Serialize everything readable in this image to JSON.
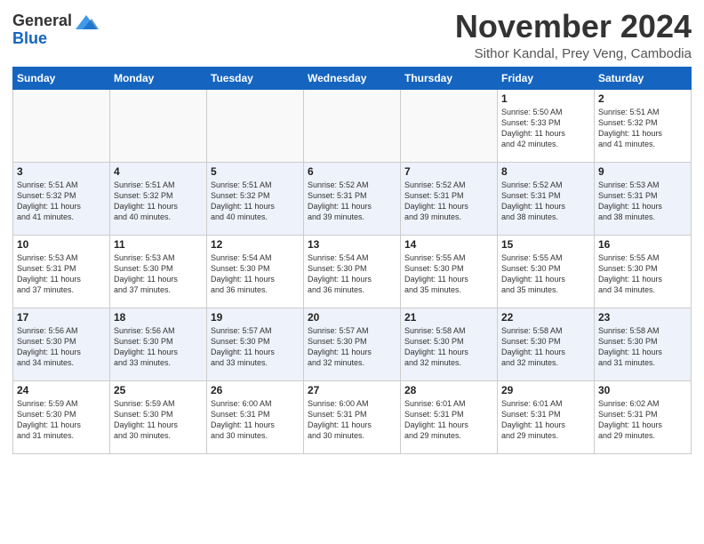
{
  "logo": {
    "general": "General",
    "blue": "Blue"
  },
  "header": {
    "month": "November 2024",
    "location": "Sithor Kandal, Prey Veng, Cambodia"
  },
  "weekdays": [
    "Sunday",
    "Monday",
    "Tuesday",
    "Wednesday",
    "Thursday",
    "Friday",
    "Saturday"
  ],
  "weeks": [
    [
      {
        "day": "",
        "info": ""
      },
      {
        "day": "",
        "info": ""
      },
      {
        "day": "",
        "info": ""
      },
      {
        "day": "",
        "info": ""
      },
      {
        "day": "",
        "info": ""
      },
      {
        "day": "1",
        "info": "Sunrise: 5:50 AM\nSunset: 5:33 PM\nDaylight: 11 hours\nand 42 minutes."
      },
      {
        "day": "2",
        "info": "Sunrise: 5:51 AM\nSunset: 5:32 PM\nDaylight: 11 hours\nand 41 minutes."
      }
    ],
    [
      {
        "day": "3",
        "info": "Sunrise: 5:51 AM\nSunset: 5:32 PM\nDaylight: 11 hours\nand 41 minutes."
      },
      {
        "day": "4",
        "info": "Sunrise: 5:51 AM\nSunset: 5:32 PM\nDaylight: 11 hours\nand 40 minutes."
      },
      {
        "day": "5",
        "info": "Sunrise: 5:51 AM\nSunset: 5:32 PM\nDaylight: 11 hours\nand 40 minutes."
      },
      {
        "day": "6",
        "info": "Sunrise: 5:52 AM\nSunset: 5:31 PM\nDaylight: 11 hours\nand 39 minutes."
      },
      {
        "day": "7",
        "info": "Sunrise: 5:52 AM\nSunset: 5:31 PM\nDaylight: 11 hours\nand 39 minutes."
      },
      {
        "day": "8",
        "info": "Sunrise: 5:52 AM\nSunset: 5:31 PM\nDaylight: 11 hours\nand 38 minutes."
      },
      {
        "day": "9",
        "info": "Sunrise: 5:53 AM\nSunset: 5:31 PM\nDaylight: 11 hours\nand 38 minutes."
      }
    ],
    [
      {
        "day": "10",
        "info": "Sunrise: 5:53 AM\nSunset: 5:31 PM\nDaylight: 11 hours\nand 37 minutes."
      },
      {
        "day": "11",
        "info": "Sunrise: 5:53 AM\nSunset: 5:30 PM\nDaylight: 11 hours\nand 37 minutes."
      },
      {
        "day": "12",
        "info": "Sunrise: 5:54 AM\nSunset: 5:30 PM\nDaylight: 11 hours\nand 36 minutes."
      },
      {
        "day": "13",
        "info": "Sunrise: 5:54 AM\nSunset: 5:30 PM\nDaylight: 11 hours\nand 36 minutes."
      },
      {
        "day": "14",
        "info": "Sunrise: 5:55 AM\nSunset: 5:30 PM\nDaylight: 11 hours\nand 35 minutes."
      },
      {
        "day": "15",
        "info": "Sunrise: 5:55 AM\nSunset: 5:30 PM\nDaylight: 11 hours\nand 35 minutes."
      },
      {
        "day": "16",
        "info": "Sunrise: 5:55 AM\nSunset: 5:30 PM\nDaylight: 11 hours\nand 34 minutes."
      }
    ],
    [
      {
        "day": "17",
        "info": "Sunrise: 5:56 AM\nSunset: 5:30 PM\nDaylight: 11 hours\nand 34 minutes."
      },
      {
        "day": "18",
        "info": "Sunrise: 5:56 AM\nSunset: 5:30 PM\nDaylight: 11 hours\nand 33 minutes."
      },
      {
        "day": "19",
        "info": "Sunrise: 5:57 AM\nSunset: 5:30 PM\nDaylight: 11 hours\nand 33 minutes."
      },
      {
        "day": "20",
        "info": "Sunrise: 5:57 AM\nSunset: 5:30 PM\nDaylight: 11 hours\nand 32 minutes."
      },
      {
        "day": "21",
        "info": "Sunrise: 5:58 AM\nSunset: 5:30 PM\nDaylight: 11 hours\nand 32 minutes."
      },
      {
        "day": "22",
        "info": "Sunrise: 5:58 AM\nSunset: 5:30 PM\nDaylight: 11 hours\nand 32 minutes."
      },
      {
        "day": "23",
        "info": "Sunrise: 5:58 AM\nSunset: 5:30 PM\nDaylight: 11 hours\nand 31 minutes."
      }
    ],
    [
      {
        "day": "24",
        "info": "Sunrise: 5:59 AM\nSunset: 5:30 PM\nDaylight: 11 hours\nand 31 minutes."
      },
      {
        "day": "25",
        "info": "Sunrise: 5:59 AM\nSunset: 5:30 PM\nDaylight: 11 hours\nand 30 minutes."
      },
      {
        "day": "26",
        "info": "Sunrise: 6:00 AM\nSunset: 5:31 PM\nDaylight: 11 hours\nand 30 minutes."
      },
      {
        "day": "27",
        "info": "Sunrise: 6:00 AM\nSunset: 5:31 PM\nDaylight: 11 hours\nand 30 minutes."
      },
      {
        "day": "28",
        "info": "Sunrise: 6:01 AM\nSunset: 5:31 PM\nDaylight: 11 hours\nand 29 minutes."
      },
      {
        "day": "29",
        "info": "Sunrise: 6:01 AM\nSunset: 5:31 PM\nDaylight: 11 hours\nand 29 minutes."
      },
      {
        "day": "30",
        "info": "Sunrise: 6:02 AM\nSunset: 5:31 PM\nDaylight: 11 hours\nand 29 minutes."
      }
    ]
  ]
}
